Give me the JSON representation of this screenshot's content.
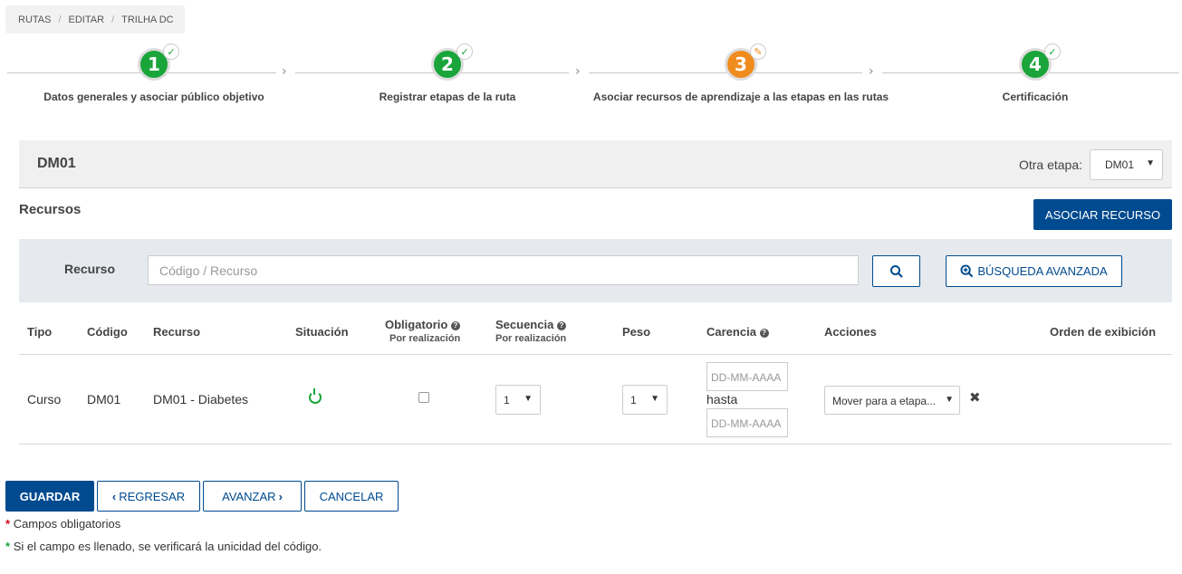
{
  "breadcrumb": [
    "RUTAS",
    "EDITAR",
    "TRILHA DC"
  ],
  "steps": [
    {
      "number": "1",
      "label": "Datos generales y asociar público objetivo",
      "status": "done"
    },
    {
      "number": "2",
      "label": "Registrar etapas de la ruta",
      "status": "done"
    },
    {
      "number": "3",
      "label": "Asociar recursos de aprendizaje a las etapas en las rutas",
      "status": "editing"
    },
    {
      "number": "4",
      "label": "Certificación",
      "status": "done"
    }
  ],
  "etapa": {
    "title": "DM01",
    "other_label": "Otra etapa:",
    "selected": "DM01"
  },
  "recursos": {
    "title": "Recursos",
    "associate_button": "ASOCIAR RECURSO"
  },
  "search": {
    "label": "Recurso",
    "placeholder": "Código / Recurso",
    "advanced_button": "BÚSQUEDA AVANZADA"
  },
  "table": {
    "headers": {
      "tipo": "Tipo",
      "codigo": "Código",
      "recurso": "Recurso",
      "situacion": "Situación",
      "obligatorio": "Obligatorio",
      "obligatorio_sub": "Por realización",
      "secuencia": "Secuencia",
      "secuencia_sub": "Por realización",
      "peso": "Peso",
      "carencia": "Carencia",
      "acciones": "Acciones",
      "orden": "Orden de exibición"
    },
    "rows": [
      {
        "tipo": "Curso",
        "codigo": "DM01",
        "recurso": "DM01 - Diabetes",
        "situacion": "active",
        "obligatorio": false,
        "secuencia": "1",
        "peso": "1",
        "carencia_from_placeholder": "DD-MM-AAAA",
        "carencia_sep": "hasta",
        "carencia_to_placeholder": "DD-MM-AAAA",
        "accion": "Mover para a etapa..."
      }
    ]
  },
  "buttons": {
    "save": "GUARDAR",
    "back": "REGRESAR",
    "next": "AVANZAR",
    "cancel": "CANCELAR"
  },
  "notes": {
    "required_mark": "*",
    "required": "Campos obligatorios",
    "unique_mark": "*",
    "unique": "Si el campo es llenado, se verificará la unicidad del código."
  },
  "colors": {
    "primary": "#004a8f",
    "success": "#1aa53a",
    "warning": "#f08b1e"
  }
}
